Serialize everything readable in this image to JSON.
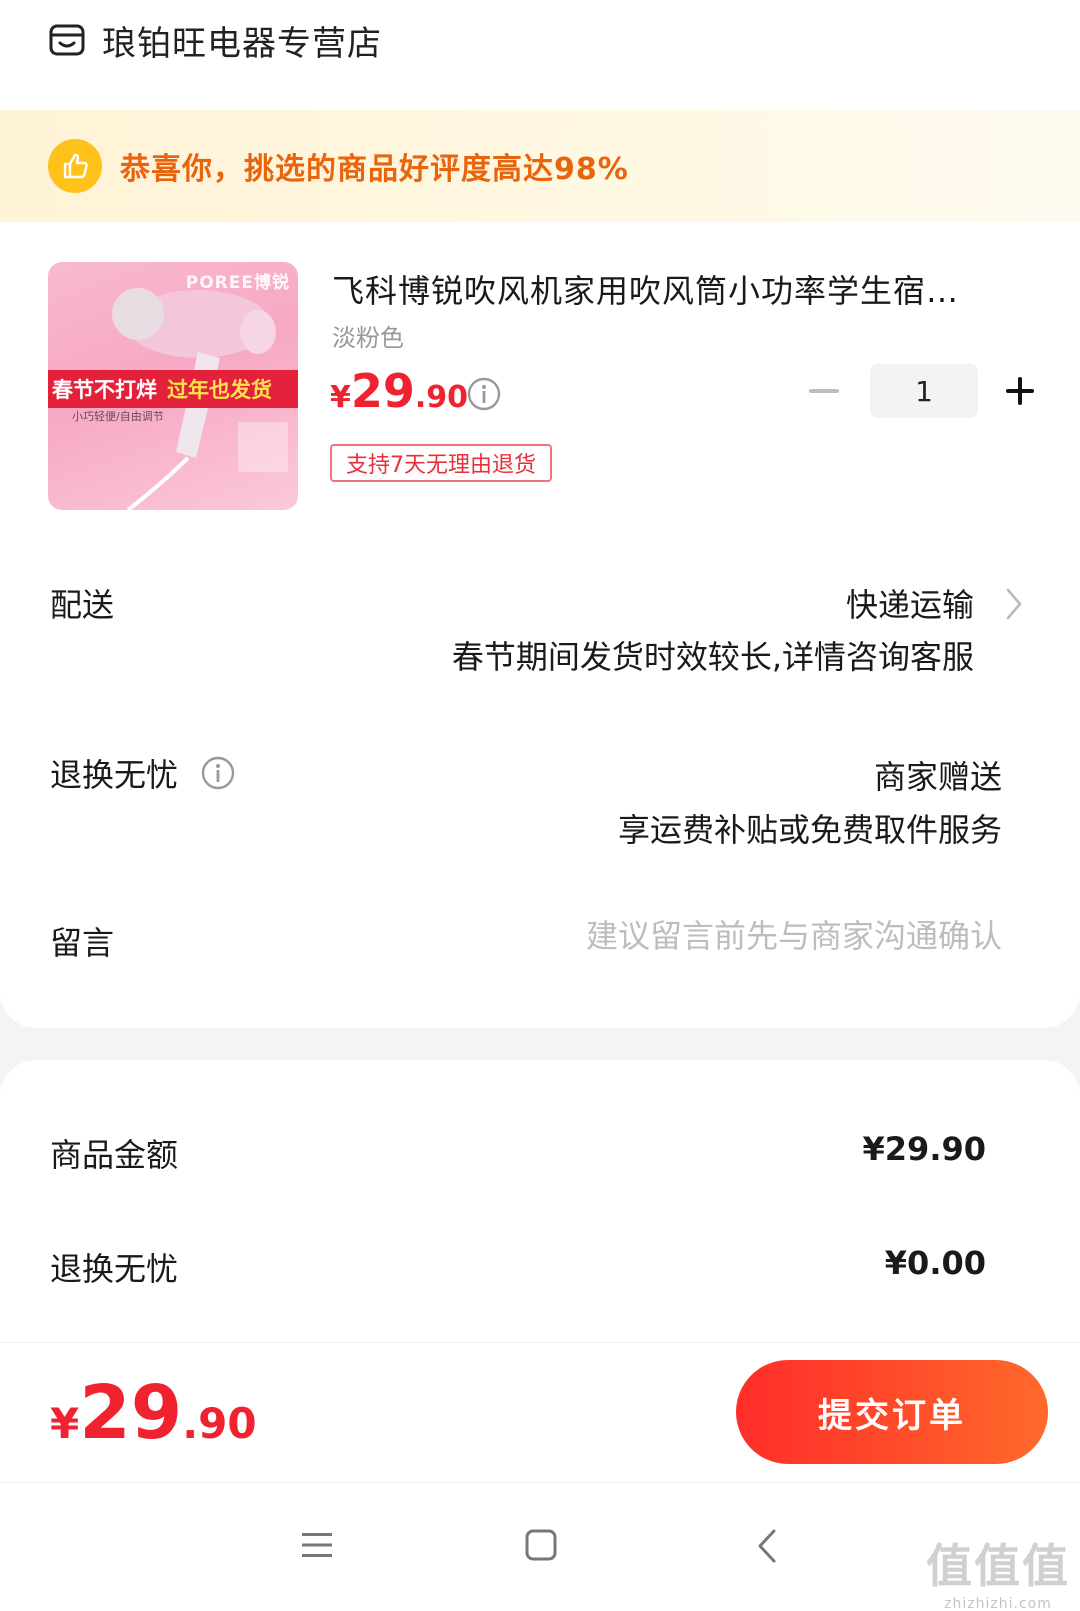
{
  "store": {
    "name": "琅铂旺电器专营店",
    "icon": "shop-icon"
  },
  "banner": {
    "text": "恭喜你，挑选的商品好评度高达98%",
    "icon": "thumbs-up-icon"
  },
  "product": {
    "image_brand": "POREE博锐",
    "image_ribbon_left": "春节不打烊",
    "image_ribbon_right": "过年也发货",
    "image_subtext": "小巧轻便/自由调节",
    "title": "飞科博锐吹风机家用吹风筒小功率学生宿…",
    "variant": "淡粉色",
    "price_yen": "¥",
    "price_int": "29",
    "price_dec": ".90",
    "quantity": "1",
    "return_policy": "支持7天无理由退货"
  },
  "shipping": {
    "label": "配送",
    "method": "快递运输",
    "note": "春节期间发货时效较长,详情咨询客服"
  },
  "worry_free": {
    "label": "退换无忧",
    "value": "商家赠送",
    "note": "享运费补贴或免费取件服务"
  },
  "message": {
    "label": "留言",
    "placeholder": "建议留言前先与商家沟通确认"
  },
  "summary": {
    "goods_label": "商品金额",
    "goods_value": "¥29.90",
    "worry_label": "退换无忧",
    "worry_value": "¥0.00"
  },
  "checkout": {
    "total_yen": "¥",
    "total_int": "29",
    "total_dec": ".90",
    "submit_label": "提交订单"
  },
  "watermark": {
    "big": "值值值",
    "small": "zhizhizhi.com"
  },
  "colors": {
    "accent": "#f0222f",
    "banner_text": "#e8650e",
    "button_start": "#ff2d2a",
    "button_end": "#ff6a2b"
  }
}
